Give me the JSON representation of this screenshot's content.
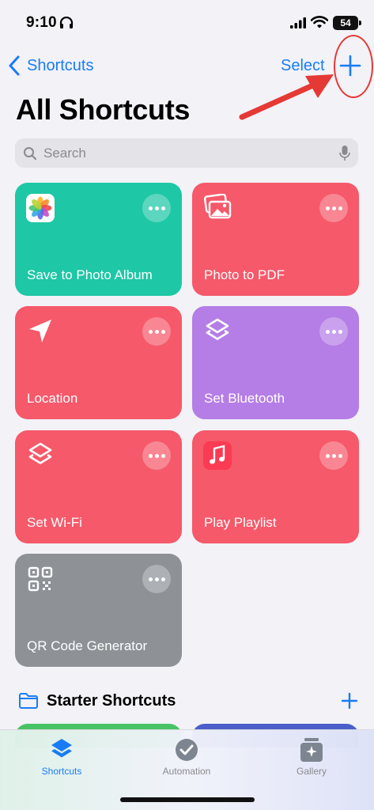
{
  "status_bar": {
    "time": "9:10",
    "battery": "54"
  },
  "nav": {
    "back_label": "Shortcuts",
    "select_label": "Select"
  },
  "title": "All Shortcuts",
  "search": {
    "placeholder": "Search"
  },
  "shortcuts": [
    {
      "label": "Save to Photo Album",
      "icon": "photos-icon",
      "color": "#1ec7a5"
    },
    {
      "label": "Photo to PDF",
      "icon": "photos-stack-icon",
      "color": "#f5596a"
    },
    {
      "label": "Location",
      "icon": "location-arrow-icon",
      "color": "#f5596a"
    },
    {
      "label": "Set Bluetooth",
      "icon": "layers-icon",
      "color": "#b57de6"
    },
    {
      "label": "Set Wi-Fi",
      "icon": "layers-icon",
      "color": "#f5596a"
    },
    {
      "label": "Play Playlist",
      "icon": "music-note-icon",
      "color": "#f5596a"
    },
    {
      "label": "QR Code Generator",
      "icon": "qr-code-icon",
      "color": "#8e9297"
    }
  ],
  "section": {
    "title": "Starter Shortcuts"
  },
  "tabs": [
    {
      "label": "Shortcuts",
      "icon": "layers-icon",
      "active": true
    },
    {
      "label": "Automation",
      "icon": "clock-check-icon",
      "active": false
    },
    {
      "label": "Gallery",
      "icon": "gallery-icon",
      "active": false
    }
  ],
  "colors": {
    "accent": "#1a7cf5",
    "annotation": "#e53935"
  }
}
